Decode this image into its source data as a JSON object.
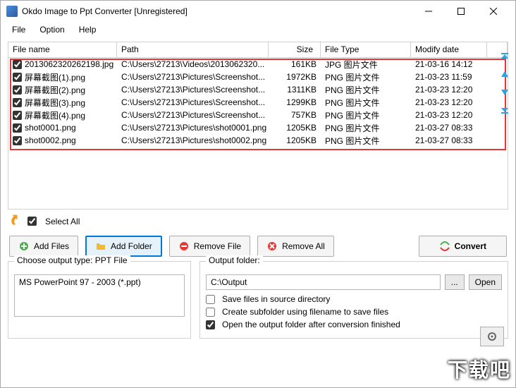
{
  "window": {
    "title": "Okdo Image to Ppt Converter [Unregistered]"
  },
  "menu": {
    "file": "File",
    "option": "Option",
    "help": "Help"
  },
  "columns": {
    "name": "File name",
    "path": "Path",
    "size": "Size",
    "type": "File Type",
    "date": "Modify date"
  },
  "rows": [
    {
      "checked": true,
      "name": "2013062320262198.jpg",
      "path": "C:\\Users\\27213\\Videos\\2013062320...",
      "size": "161KB",
      "type": "JPG 图片文件",
      "date": "21-03-16 14:12"
    },
    {
      "checked": true,
      "name": "屏幕截图(1).png",
      "path": "C:\\Users\\27213\\Pictures\\Screenshot...",
      "size": "1972KB",
      "type": "PNG 图片文件",
      "date": "21-03-23 11:59"
    },
    {
      "checked": true,
      "name": "屏幕截图(2).png",
      "path": "C:\\Users\\27213\\Pictures\\Screenshot...",
      "size": "1311KB",
      "type": "PNG 图片文件",
      "date": "21-03-23 12:20"
    },
    {
      "checked": true,
      "name": "屏幕截图(3).png",
      "path": "C:\\Users\\27213\\Pictures\\Screenshot...",
      "size": "1299KB",
      "type": "PNG 图片文件",
      "date": "21-03-23 12:20"
    },
    {
      "checked": true,
      "name": "屏幕截图(4).png",
      "path": "C:\\Users\\27213\\Pictures\\Screenshot...",
      "size": "757KB",
      "type": "PNG 图片文件",
      "date": "21-03-23 12:20"
    },
    {
      "checked": true,
      "name": "shot0001.png",
      "path": "C:\\Users\\27213\\Pictures\\shot0001.png",
      "size": "1205KB",
      "type": "PNG 图片文件",
      "date": "21-03-27 08:33"
    },
    {
      "checked": true,
      "name": "shot0002.png",
      "path": "C:\\Users\\27213\\Pictures\\shot0002.png",
      "size": "1205KB",
      "type": "PNG 图片文件",
      "date": "21-03-27 08:33"
    }
  ],
  "selectAll": "Select All",
  "buttons": {
    "addFiles": "Add Files",
    "addFolder": "Add Folder",
    "removeFile": "Remove File",
    "removeAll": "Remove All",
    "convert": "Convert"
  },
  "outputType": {
    "label": "Choose output type:",
    "value": "PPT File",
    "selected": "MS PowerPoint 97 - 2003 (*.ppt)"
  },
  "outputFolder": {
    "label": "Output folder:",
    "path": "C:\\Output",
    "browse": "...",
    "open": "Open"
  },
  "options": {
    "saveInSource": "Save files in source directory",
    "createSubfolder": "Create subfolder using filename to save files",
    "openAfter": "Open the output folder after conversion finished",
    "saveInSourceChecked": false,
    "createSubfolderChecked": false,
    "openAfterChecked": true
  },
  "watermark": "下载吧"
}
